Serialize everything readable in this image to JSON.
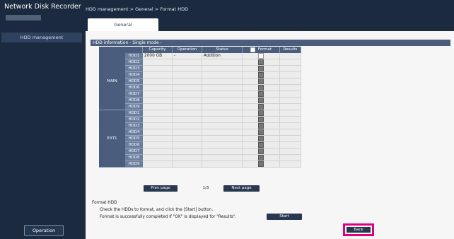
{
  "app": {
    "title": "Network Disk Recorder"
  },
  "sidebar": {
    "items": [
      {
        "label": "HDD management"
      }
    ]
  },
  "footer": {
    "operation_label": "Operation"
  },
  "breadcrumb": {
    "text": "HDD management > General > Format HDD"
  },
  "tabs": [
    {
      "label": "General",
      "active": true
    }
  ],
  "section": {
    "title": "HDD information - Single mode -"
  },
  "table": {
    "headers": {
      "capacity": "Capacity",
      "operation": "Operation",
      "status": "Status",
      "format": "Format",
      "results": "Results"
    },
    "groups": [
      {
        "name": "MAIN",
        "hdds": [
          "HDD1",
          "HDD2",
          "HDD3",
          "HDD4",
          "HDD5",
          "HDD6",
          "HDD7",
          "HDD8",
          "HDD9"
        ]
      },
      {
        "name": "EXT1",
        "hdds": [
          "HDD1",
          "HDD2",
          "HDD3",
          "HDD4",
          "HDD5",
          "HDD6",
          "HDD7",
          "HDD8",
          "HDD9"
        ]
      }
    ],
    "first_row": {
      "capacity": "2000 GB",
      "operation": "-",
      "status": "Addition"
    }
  },
  "pagination": {
    "prev_label": "Prev page",
    "page": "1/3",
    "next_label": "Next page"
  },
  "format_section": {
    "title": "Format HDD",
    "instruction1": "Check the HDDs to format, and click the [Start] button.",
    "instruction2": "Format is successfully completed if \"OK\" is displayed for \"Results\".",
    "start_label": "Start"
  },
  "back_label": "Back",
  "colors": {
    "accent_highlight": "#e0007f",
    "header_bg": "#4a5d7c",
    "sidebar_bg": "#1b2a3e"
  }
}
